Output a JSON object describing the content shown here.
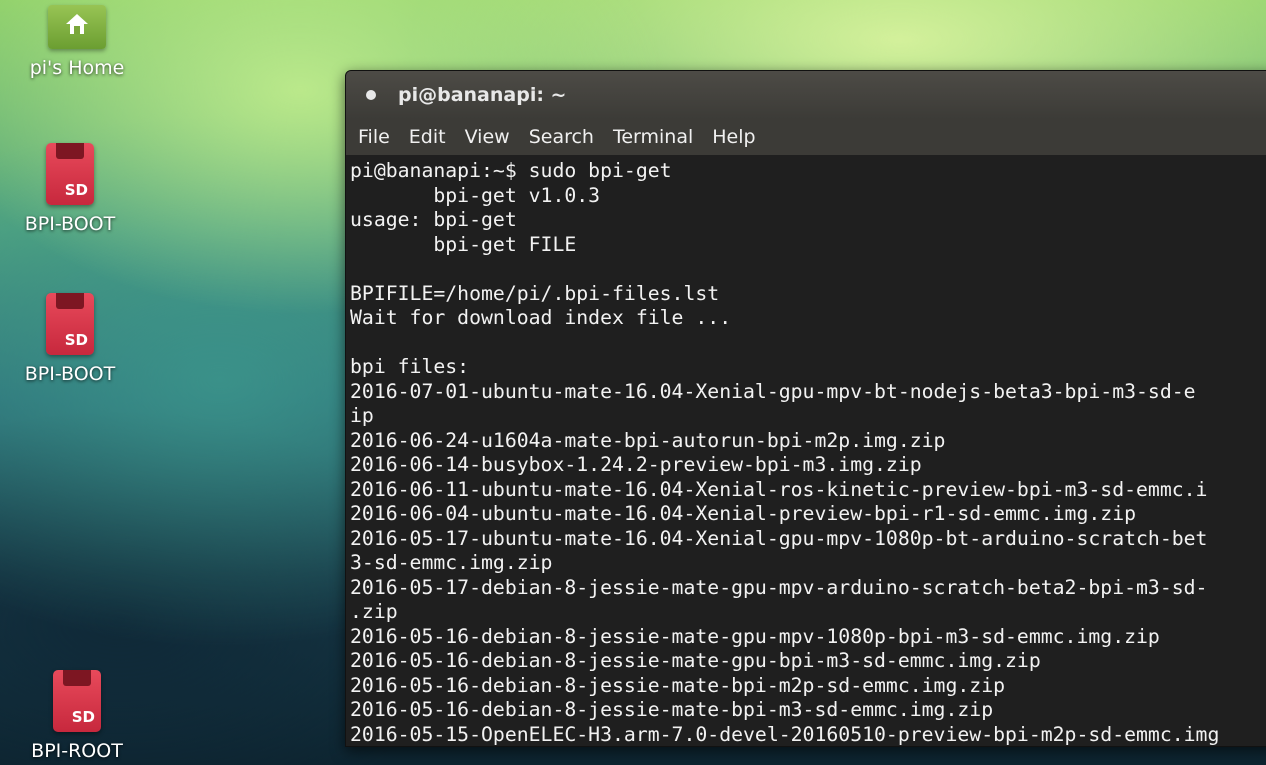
{
  "desktop": {
    "icons": [
      {
        "label": "pi's Home"
      },
      {
        "label": "BPI-BOOT",
        "badge": "SD"
      },
      {
        "label": "BPI-BOOT",
        "badge": "SD"
      },
      {
        "label": "BPI-ROOT",
        "badge": "SD"
      }
    ]
  },
  "terminal": {
    "title": "pi@bananapi: ~",
    "menu": [
      "File",
      "Edit",
      "View",
      "Search",
      "Terminal",
      "Help"
    ],
    "lines": [
      "pi@bananapi:~$ sudo bpi-get",
      "       bpi-get v1.0.3",
      "usage: bpi-get",
      "       bpi-get FILE",
      "",
      "BPIFILE=/home/pi/.bpi-files.lst",
      "Wait for download index file ...",
      "",
      "bpi files:",
      "2016-07-01-ubuntu-mate-16.04-Xenial-gpu-mpv-bt-nodejs-beta3-bpi-m3-sd-e",
      "ip",
      "2016-06-24-u1604a-mate-bpi-autorun-bpi-m2p.img.zip",
      "2016-06-14-busybox-1.24.2-preview-bpi-m3.img.zip",
      "2016-06-11-ubuntu-mate-16.04-Xenial-ros-kinetic-preview-bpi-m3-sd-emmc.i",
      "2016-06-04-ubuntu-mate-16.04-Xenial-preview-bpi-r1-sd-emmc.img.zip",
      "2016-05-17-ubuntu-mate-16.04-Xenial-gpu-mpv-1080p-bt-arduino-scratch-bet",
      "3-sd-emmc.img.zip",
      "2016-05-17-debian-8-jessie-mate-gpu-mpv-arduino-scratch-beta2-bpi-m3-sd-",
      ".zip",
      "2016-05-16-debian-8-jessie-mate-gpu-mpv-1080p-bpi-m3-sd-emmc.img.zip",
      "2016-05-16-debian-8-jessie-mate-gpu-bpi-m3-sd-emmc.img.zip",
      "2016-05-16-debian-8-jessie-mate-bpi-m2p-sd-emmc.img.zip",
      "2016-05-16-debian-8-jessie-mate-bpi-m3-sd-emmc.img.zip",
      "2016-05-15-OpenELEC-H3.arm-7.0-devel-20160510-preview-bpi-m2p-sd-emmc.img"
    ]
  }
}
